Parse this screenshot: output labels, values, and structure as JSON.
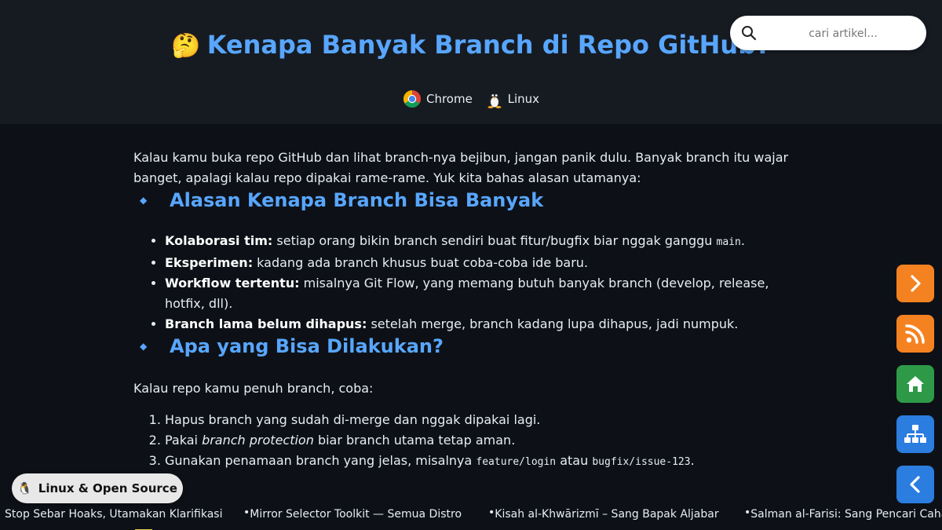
{
  "header": {
    "emoji": "🤔",
    "title": "Kenapa Banyak Branch di Repo GitHub?",
    "platforms": [
      "Chrome",
      "Linux"
    ]
  },
  "search": {
    "placeholder": "cari artikel..."
  },
  "article": {
    "intro": "Kalau kamu buka repo GitHub dan lihat branch-nya bejibun, jangan panik dulu. Banyak branch itu wajar banget, apalagi kalau repo dipakai rame-rame. Yuk kita bahas alasan utamanya:",
    "section1": {
      "heading": "Alasan Kenapa Branch Bisa Banyak",
      "items": [
        {
          "bold": "Kolaborasi tim:",
          "text": " setiap orang bikin branch sendiri buat fitur/bugfix biar nggak ganggu ",
          "code": "main",
          "tail": "."
        },
        {
          "bold": "Eksperimen:",
          "text": " kadang ada branch khusus buat coba-coba ide baru."
        },
        {
          "bold": "Workflow tertentu:",
          "text": " misalnya Git Flow, yang memang butuh banyak branch (develop, release, hotfix, dll)."
        },
        {
          "bold": "Branch lama belum dihapus:",
          "text": " setelah merge, branch kadang lupa dihapus, jadi numpuk."
        }
      ]
    },
    "section2": {
      "heading": "Apa yang Bisa Dilakukan?",
      "intro": "Kalau repo kamu penuh branch, coba:",
      "items": [
        {
          "text": "Hapus branch yang sudah di-merge dan nggak dipakai lagi."
        },
        {
          "pre": "Pakai ",
          "em": "branch protection",
          "text": " biar branch utama tetap aman."
        },
        {
          "text": "Gunakan penamaan branch yang jelas, misalnya ",
          "code1": "feature/login",
          "mid": " atau ",
          "code2": "bugfix/issue-123",
          "tail": "."
        }
      ]
    }
  },
  "side_buttons": [
    {
      "name": "next",
      "icon": "chevron-right-icon",
      "color": "#f58220"
    },
    {
      "name": "rss",
      "icon": "rss-icon",
      "color": "#f58220"
    },
    {
      "name": "home",
      "icon": "home-icon",
      "color": "#2e9a48"
    },
    {
      "name": "sitemap",
      "icon": "sitemap-icon",
      "color": "#2b7de0"
    },
    {
      "name": "back",
      "icon": "chevron-left-icon",
      "color": "#2b7de0"
    }
  ],
  "badge": {
    "icon": "🐧",
    "label": "Linux & Open Source"
  },
  "ticker": {
    "items": [
      "Stop Sebar Hoaks, Utamakan Klarifikasi",
      "Mirror Selector Toolkit — Semua Distro",
      "Kisah al-Khwārizmī – Sang Bapak Aljabar",
      "Salman al-Farisi: Sang Pencari Cahaya"
    ]
  }
}
